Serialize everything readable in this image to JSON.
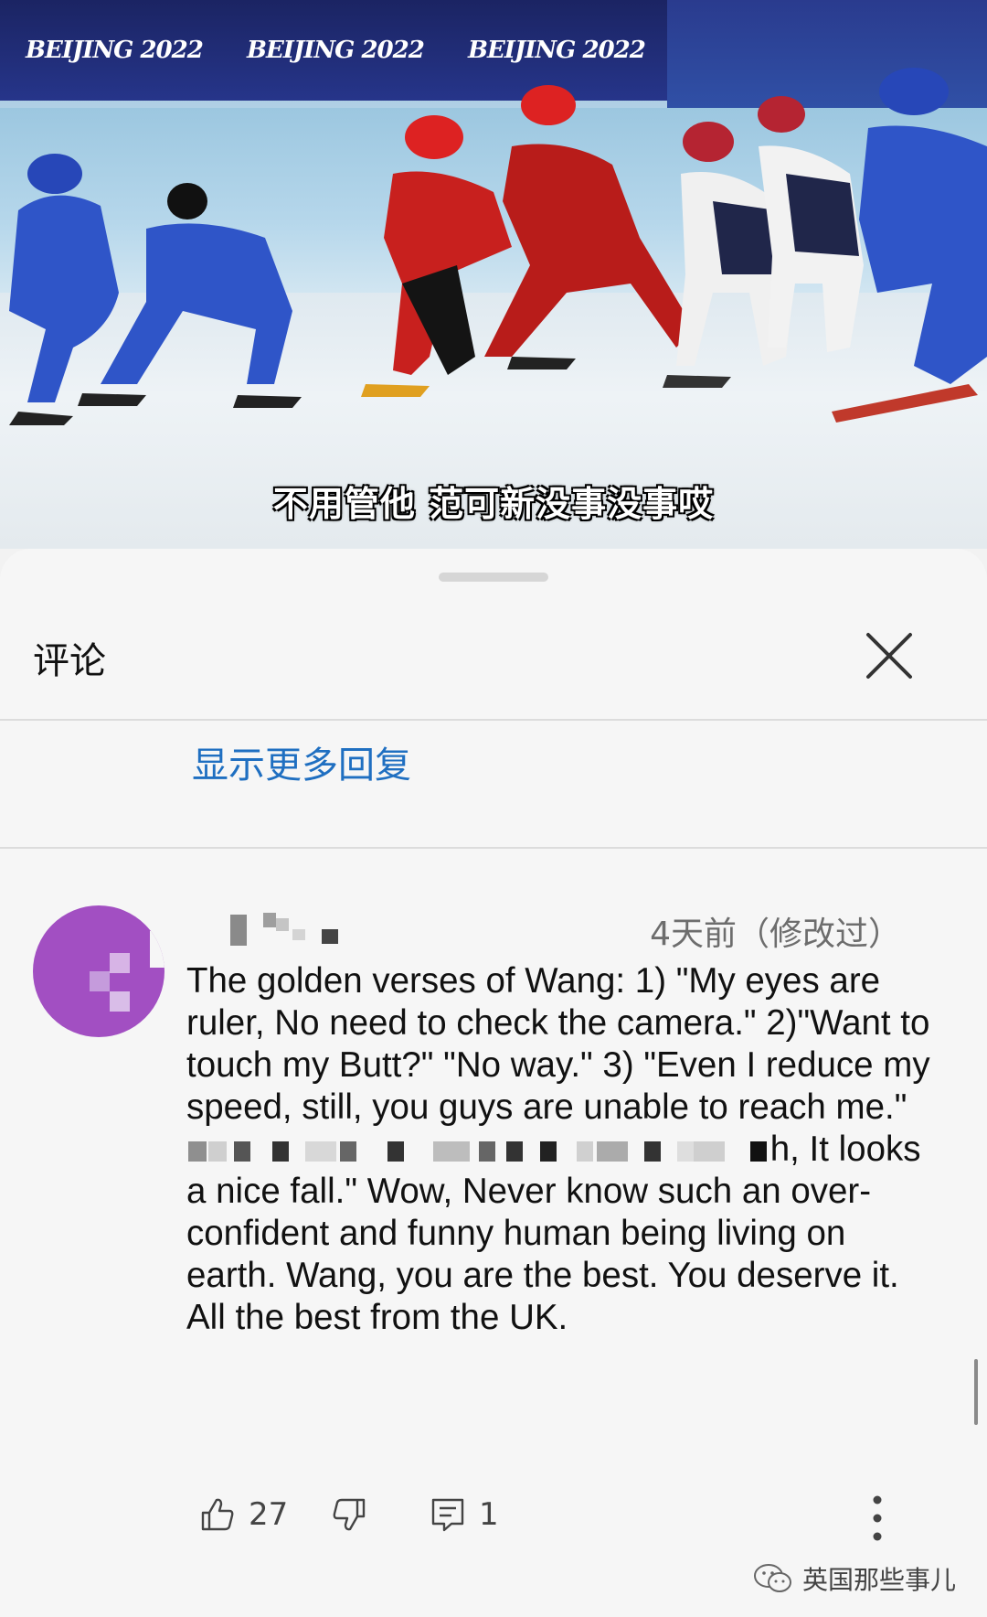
{
  "video": {
    "banner_logo": "BEIJING 2022",
    "subtitle": "不用管他 范可新没事没事哎"
  },
  "sheet": {
    "title": "评论",
    "show_more_replies": "显示更多回复"
  },
  "comment": {
    "timestamp": "4天前（修改过）",
    "text_part1": "The golden verses of Wang: 1) \"My eyes are ruler, No need to check the camera.\" 2)\"Want to touch my Butt?\" \"No way.\" 3) \"Even I reduce my speed, still, you guys are unable to reach me.\"",
    "text_part2": "h, It looks a nice fall.\" Wow, Never know such an over-confident and funny human being living on earth. Wang, you are the best. You deserve it. All the best from the UK.",
    "likes": "27",
    "replies": "1"
  },
  "watermark": {
    "text": "英国那些事儿"
  },
  "colors": {
    "link_blue": "#1f6fc1",
    "avatar_purple": "#a24fc2",
    "banner_navy": "#1b2463"
  },
  "icons": {
    "close": "close-icon",
    "like": "thumbs-up-icon",
    "dislike": "thumbs-down-icon",
    "reply": "comment-icon",
    "more": "more-vertical-icon",
    "watermark": "wechat-icon"
  }
}
